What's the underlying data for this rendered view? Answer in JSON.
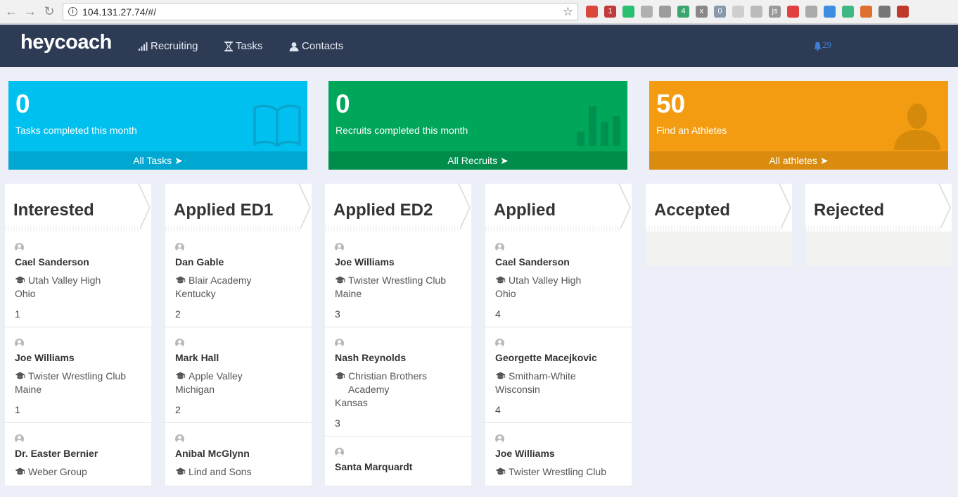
{
  "browser": {
    "url": "104.131.27.74/#/",
    "extension_badges": [
      "1",
      "4",
      "x",
      "0",
      "js"
    ]
  },
  "app": {
    "brand": "heycoach",
    "nav": [
      {
        "label": "Recruiting",
        "icon": "signal-icon"
      },
      {
        "label": "Tasks",
        "icon": "hourglass-icon"
      },
      {
        "label": "Contacts",
        "icon": "user-icon"
      }
    ],
    "notifications_count": "29"
  },
  "stats": [
    {
      "value": "0",
      "label": "Tasks completed this month",
      "link": "All Tasks",
      "color": "#00c0ef",
      "footer_color": "#00a7d0",
      "icon": "book-icon"
    },
    {
      "value": "0",
      "label": "Recruits completed this month",
      "link": "All Recruits",
      "color": "#00a65a",
      "footer_color": "#008d4c",
      "icon": "bar-chart-icon"
    },
    {
      "value": "50",
      "label": "Find an Athletes",
      "link": "All athletes",
      "color": "#f39c12",
      "footer_color": "#da8c10",
      "icon": "person-icon"
    }
  ],
  "columns": [
    {
      "title": "Interested",
      "cards": [
        {
          "name": "Cael Sanderson",
          "school": "Utah Valley High",
          "state": "Ohio",
          "rank": "1"
        },
        {
          "name": "Joe Williams",
          "school": "Twister Wrestling Club",
          "state": "Maine",
          "rank": "1"
        },
        {
          "name": "Dr. Easter Bernier",
          "school": "Weber Group",
          "state": "",
          "rank": ""
        }
      ]
    },
    {
      "title": "Applied ED1",
      "cards": [
        {
          "name": "Dan Gable",
          "school": "Blair Academy",
          "state": "Kentucky",
          "rank": "2"
        },
        {
          "name": "Mark Hall",
          "school": "Apple Valley",
          "state": "Michigan",
          "rank": "2"
        },
        {
          "name": "Anibal McGlynn",
          "school": "Lind and Sons",
          "state": "",
          "rank": ""
        }
      ]
    },
    {
      "title": "Applied ED2",
      "cards": [
        {
          "name": "Joe Williams",
          "school": "Twister Wrestling Club",
          "state": "Maine",
          "rank": "3"
        },
        {
          "name": "Nash Reynolds",
          "school": "Christian Brothers Academy",
          "state": "Kansas",
          "rank": "3"
        },
        {
          "name": "Santa Marquardt",
          "school": "",
          "state": "",
          "rank": ""
        }
      ]
    },
    {
      "title": "Applied",
      "cards": [
        {
          "name": "Cael Sanderson",
          "school": "Utah Valley High",
          "state": "Ohio",
          "rank": "4"
        },
        {
          "name": "Georgette Macejkovic",
          "school": "Smitham-White",
          "state": "Wisconsin",
          "rank": "4"
        },
        {
          "name": "Joe Williams",
          "school": "Twister Wrestling Club",
          "state": "",
          "rank": ""
        }
      ]
    },
    {
      "title": "Accepted",
      "cards": []
    },
    {
      "title": "Rejected",
      "cards": []
    }
  ]
}
